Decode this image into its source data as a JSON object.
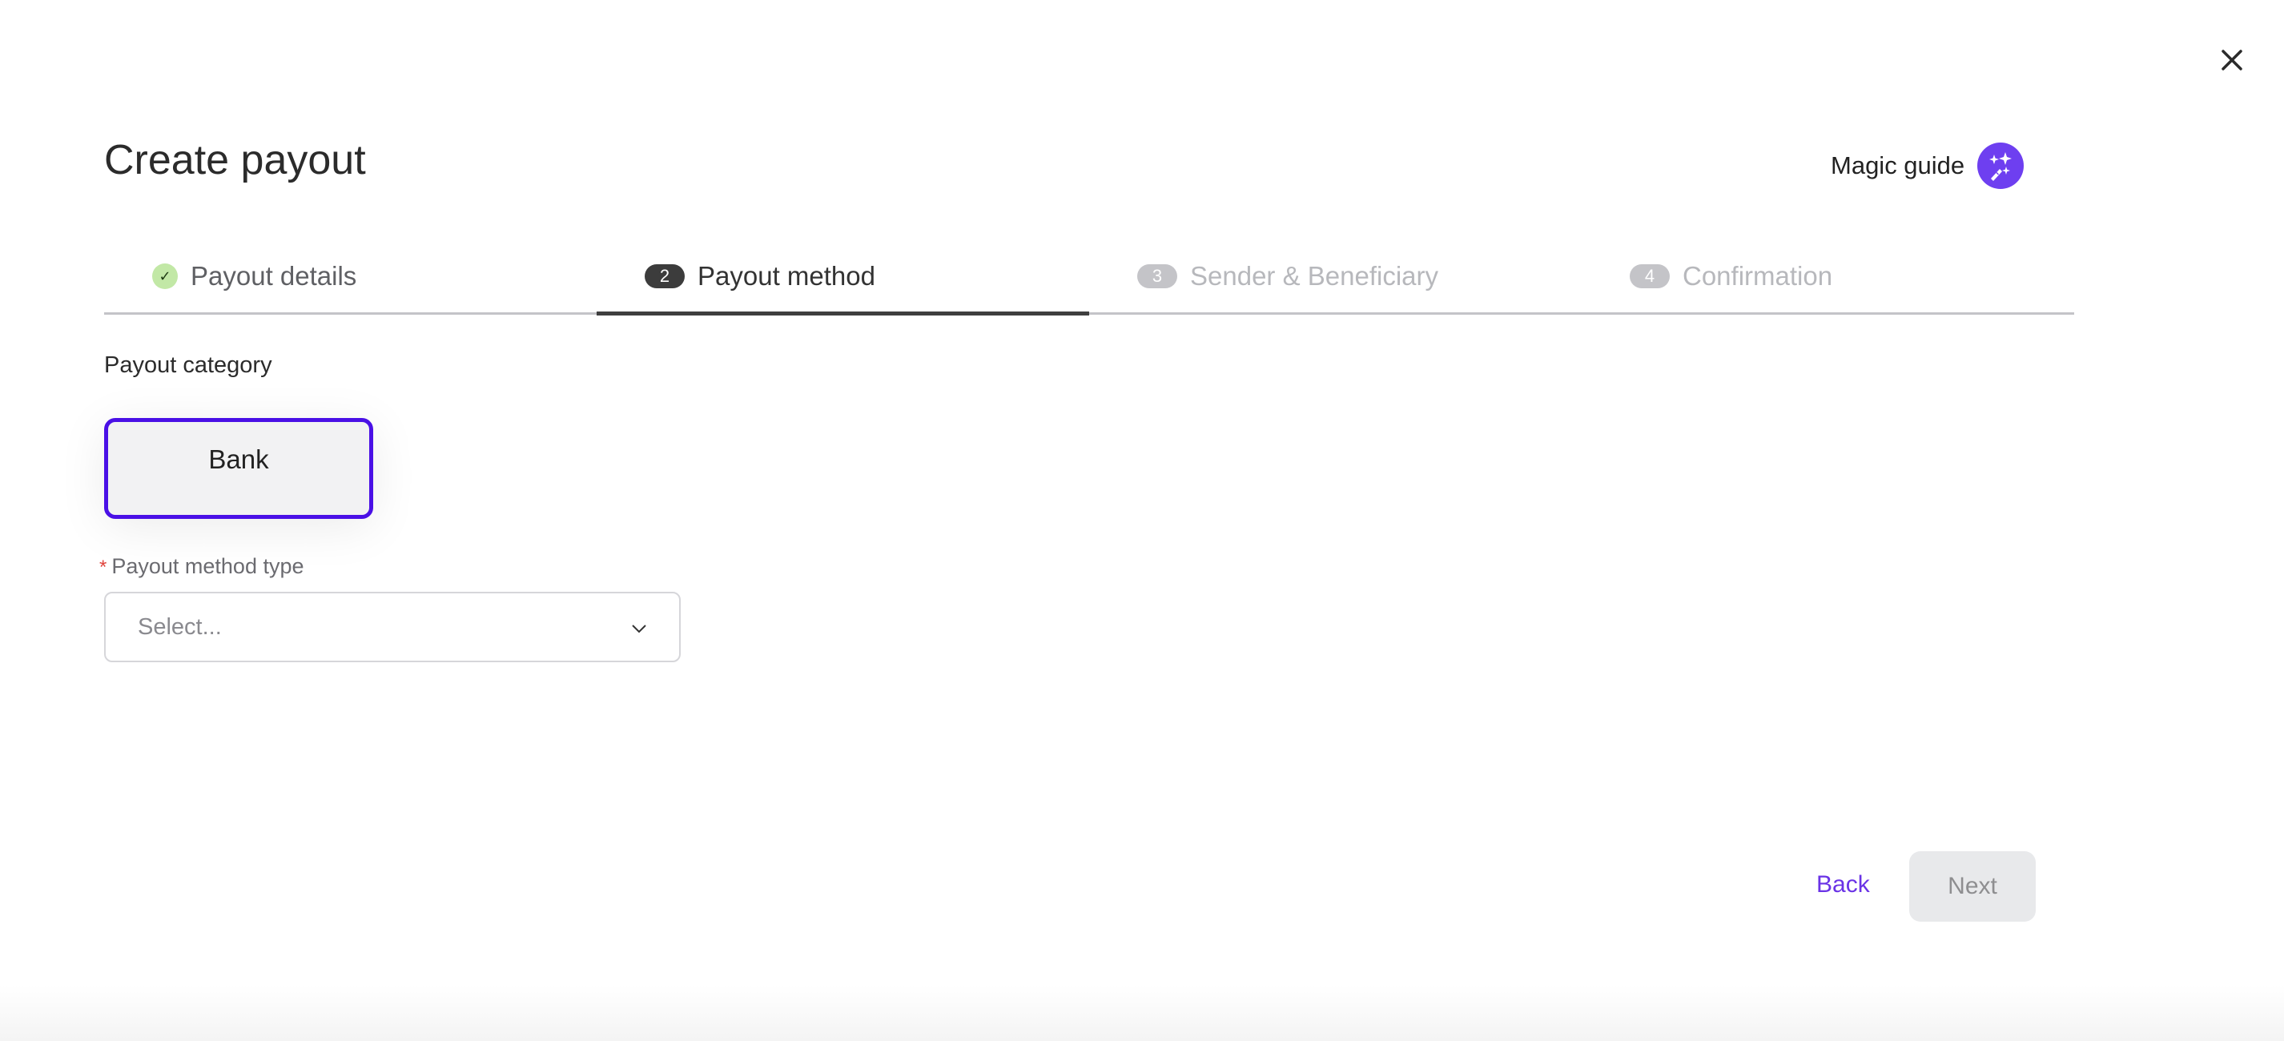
{
  "header": {
    "title": "Create payout",
    "magic_guide_label": "Magic guide",
    "magic_guide_icon": "magic-wand-sparkles-icon",
    "close_icon": "close-icon"
  },
  "steps": [
    {
      "number": "✓",
      "label": "Payout details",
      "state": "completed"
    },
    {
      "number": "2",
      "label": "Payout method",
      "state": "current"
    },
    {
      "number": "3",
      "label": "Sender & Beneficiary",
      "state": "upcoming"
    },
    {
      "number": "4",
      "label": "Confirmation",
      "state": "upcoming"
    }
  ],
  "form": {
    "category_label": "Payout category",
    "categories": [
      {
        "label": "Bank",
        "selected": true
      }
    ],
    "method_type": {
      "required_marker": "*",
      "label": "Payout method type",
      "placeholder": "Select...",
      "value": ""
    }
  },
  "footer": {
    "back_label": "Back",
    "next_label": "Next",
    "next_disabled": true
  },
  "colors": {
    "accent": "#6a33e6",
    "card_border": "#4a10e6",
    "completed_badge": "#c2e8a6",
    "required": "#e0433c"
  }
}
